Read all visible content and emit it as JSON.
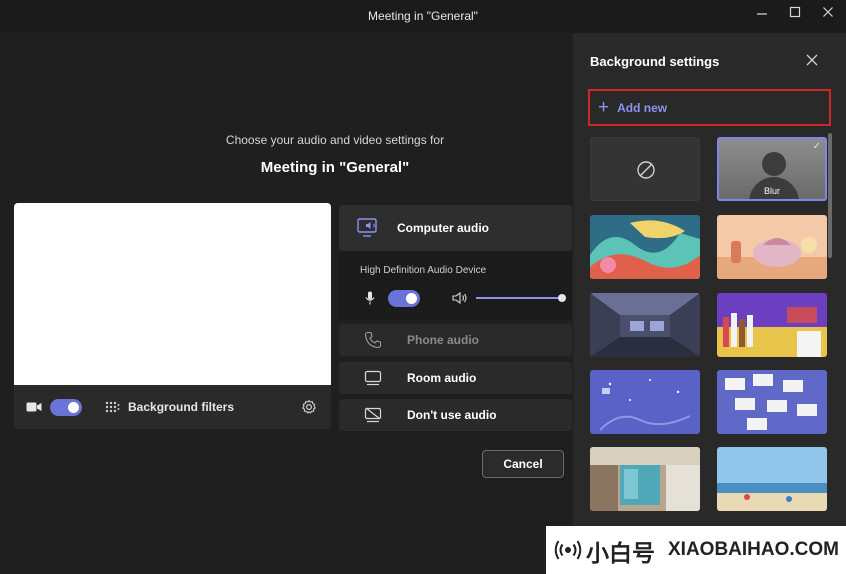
{
  "window": {
    "title": "Meeting in \"General\""
  },
  "main": {
    "prompt": "Choose your audio and video settings for",
    "meeting_title": "Meeting in \"General\"",
    "preview": {
      "camera_on": true,
      "background_filters_label": "Background filters"
    },
    "audio_options": [
      {
        "label": "Computer audio",
        "selected": true
      },
      {
        "label": "Phone audio",
        "selected": false,
        "disabled": true
      },
      {
        "label": "Room audio",
        "selected": false
      },
      {
        "label": "Don't use audio",
        "selected": false
      }
    ],
    "device": {
      "name": "High Definition Audio Device",
      "mic_on": true,
      "volume": 1.0
    },
    "cancel_label": "Cancel"
  },
  "background_panel": {
    "title": "Background settings",
    "add_new_label": "Add new",
    "blur_label": "Blur",
    "backgrounds": [
      "None",
      "Blur",
      "Wave landscape",
      "Pastel desert",
      "Dark studio",
      "Colorful shelves",
      "Purple sky",
      "Sticky notes",
      "Office hallway",
      "Beach"
    ],
    "selected": "Blur"
  },
  "watermark": {
    "brand_cn": "小白号",
    "brand_en": "XIAOBAIHAO.COM"
  },
  "colors": {
    "accent": "#6a73d6",
    "highlight_border": "#d22525",
    "background": "#1f1f1f",
    "panel": "#292929"
  }
}
